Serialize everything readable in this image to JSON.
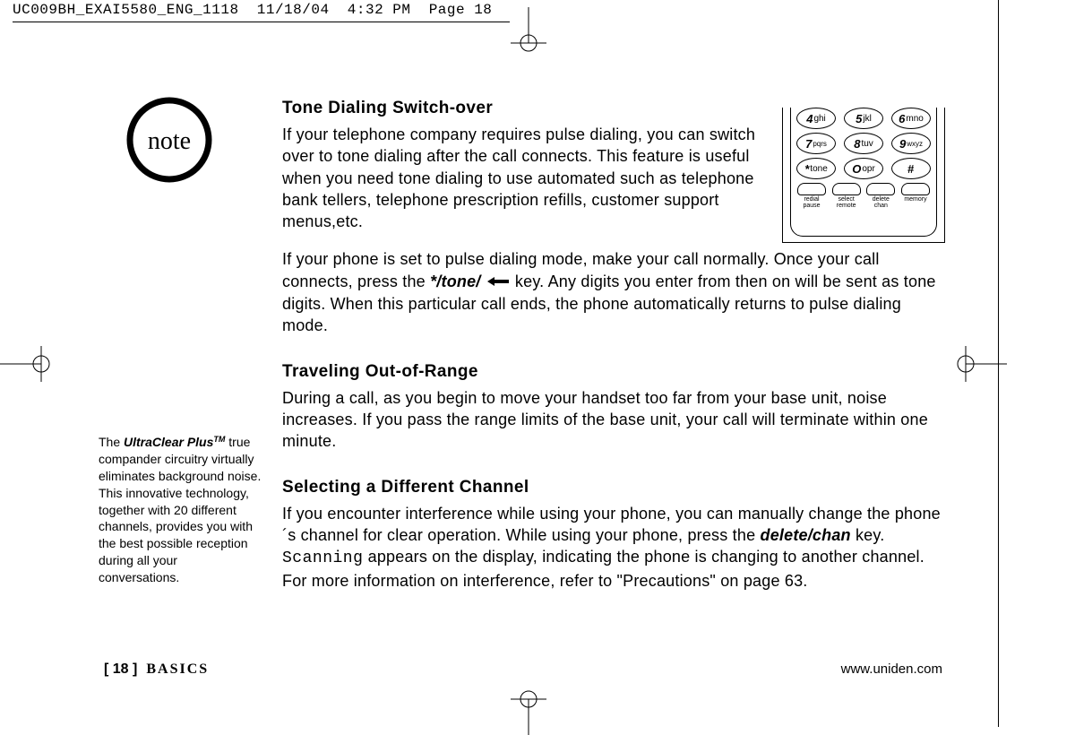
{
  "printHeader": {
    "filename": "UC009BH_EXAI5580_ENG_1118",
    "date": "11/18/04",
    "time": "4:32 PM",
    "pageLabel": "Page 18"
  },
  "noteBadge": {
    "label": "note"
  },
  "sideNote": {
    "leadBrand": "UltraClear Plus",
    "leadTM": "TM",
    "prefix": "The ",
    "body": " true compander circuitry virtually eliminates background noise. This innovative technology, together with 20 different channels, provides you with the best possible reception during all your conversations."
  },
  "sections": {
    "tone": {
      "heading": "Tone Dialing Switch-over",
      "p1": "If your telephone company requires pulse dialing, you can switch over to tone dialing after the call connects. This feature is useful when you need tone dialing to use automated such as telephone bank tellers, telephone prescription refills, customer support menus,etc.",
      "p2a": "If your phone is set to pulse dialing mode, make your call normally. Once your call connects, press the ",
      "p2Key": "*/tone/",
      "p2b": " key. Any digits you enter from then on will be sent as tone digits. When this particular call ends, the phone automatically returns to pulse dialing mode."
    },
    "range": {
      "heading": "Traveling Out-of-Range",
      "p1": "During a call, as you begin to move your handset too far from your base unit, noise increases. If you pass the range limits of the base unit, your call will terminate within one minute."
    },
    "channel": {
      "heading": "Selecting a Different Channel",
      "p1a": "If you encounter interference while using your phone, you can manually change the phone´s channel for clear operation. While using your phone, press the ",
      "p1Key": "delete/chan",
      "p1b": " key. ",
      "p1Mono": "Scanning",
      "p1c": " appears on the display, indicating the phone is changing to another channel. For more information on interference, refer to \"Precautions\" on page 63."
    }
  },
  "keypad": {
    "rows": [
      [
        {
          "n": "4",
          "l": "ghi"
        },
        {
          "n": "5",
          "l": "jkl"
        },
        {
          "n": "6",
          "l": "mno"
        }
      ],
      [
        {
          "n": "7",
          "l": "pqrs"
        },
        {
          "n": "8",
          "l": "tuv"
        },
        {
          "n": "9",
          "l": "wxyz"
        }
      ],
      [
        {
          "n": "*",
          "l": "tone"
        },
        {
          "n": "O",
          "l": "opr"
        },
        {
          "n": "#",
          "l": ""
        }
      ]
    ],
    "soft": [
      {
        "label": "redial\npause"
      },
      {
        "label": "select\nremote"
      },
      {
        "label": "delete\nchan"
      },
      {
        "label": "memory"
      }
    ]
  },
  "footer": {
    "page": "[ 18 ]",
    "section": "BASICS",
    "url": "www.uniden.com"
  }
}
